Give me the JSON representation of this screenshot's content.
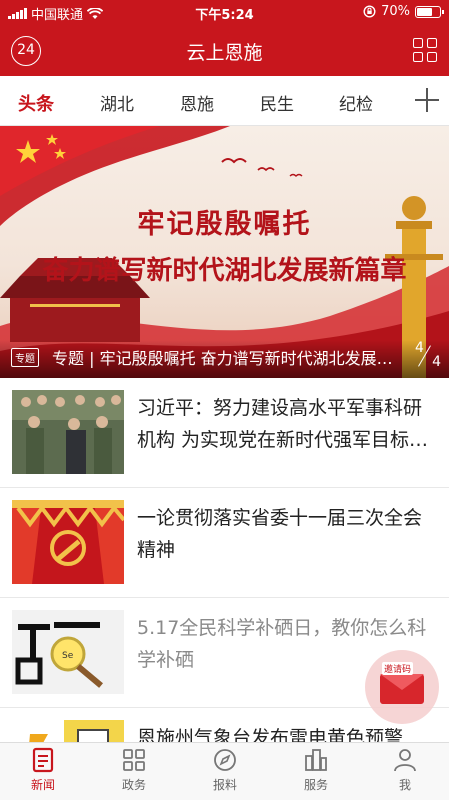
{
  "status_bar": {
    "carrier": "中国联通",
    "time": "下午5:24",
    "battery_percent": "70%",
    "battery_level": 0.7
  },
  "header": {
    "badge": "24",
    "title": "云上恩施"
  },
  "tabs": [
    {
      "label": "头条",
      "active": true
    },
    {
      "label": "湖北",
      "active": false
    },
    {
      "label": "恩施",
      "active": false
    },
    {
      "label": "民生",
      "active": false
    },
    {
      "label": "纪检",
      "active": false
    }
  ],
  "banner": {
    "headline_1": "牢记殷殷嘱托",
    "headline_2": "奋力谱写新时代湖北发展新篇章",
    "tag": "专题",
    "caption": "专题 | 牢记殷殷嘱托 奋力谱写新时代湖北发展新篇章",
    "page_current": "4",
    "page_total": "4"
  },
  "news": [
    {
      "title": "习近平：努力建设高水平军事科研机构 为实现党在新时代强军目标提供有力支撑",
      "read": false
    },
    {
      "title": "一论贯彻落实省委十一届三次全会精神",
      "read": false
    },
    {
      "title": "5.17全民科学补硒日，教你怎么科学补硒",
      "read": true
    },
    {
      "title": "恩施州气象台发布雷电黄色预警",
      "read": false
    }
  ],
  "invite": {
    "label": "邀请码"
  },
  "bottom_nav": [
    {
      "label": "新闻",
      "icon": "news-icon",
      "active": true
    },
    {
      "label": "政务",
      "icon": "grid-apps-icon",
      "active": false
    },
    {
      "label": "报料",
      "icon": "compass-icon",
      "active": false
    },
    {
      "label": "服务",
      "icon": "buildings-icon",
      "active": false
    },
    {
      "label": "我",
      "icon": "user-icon",
      "active": false
    }
  ],
  "colors": {
    "brand_red": "#c8161d",
    "text": "#222222",
    "read_text": "#8a8a8a"
  }
}
